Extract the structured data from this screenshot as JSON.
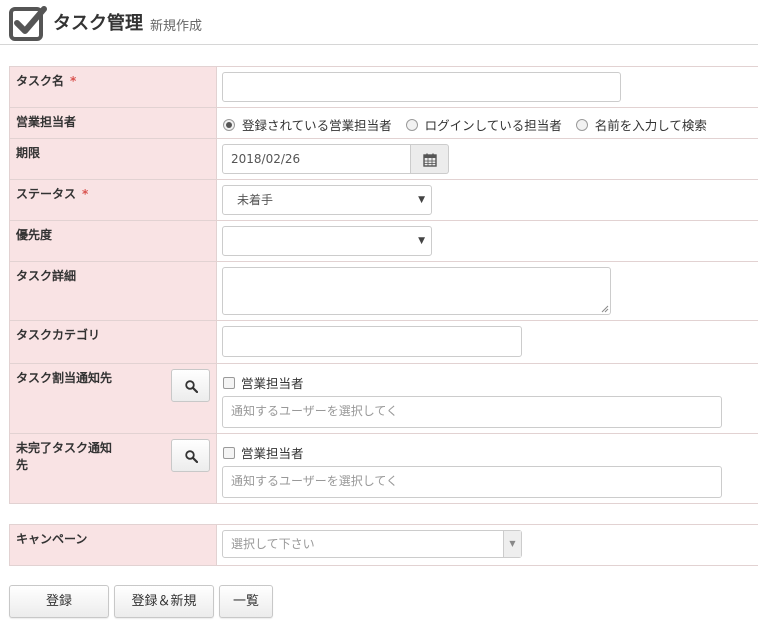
{
  "header": {
    "title": "タスク管理",
    "subtitle": "新規作成"
  },
  "fields": {
    "task_name": {
      "label": "タスク名",
      "required_mark": "*",
      "value": ""
    },
    "sales_rep": {
      "label": "営業担当者",
      "options": [
        "登録されている営業担当者",
        "ログインしている担当者",
        "名前を入力して検索"
      ],
      "selected_index": 0
    },
    "deadline": {
      "label": "期限",
      "value": "2018/02/26"
    },
    "status": {
      "label": "ステータス",
      "required_mark": "*",
      "value": "未着手"
    },
    "priority": {
      "label": "優先度",
      "value": ""
    },
    "task_detail": {
      "label": "タスク詳細",
      "value": ""
    },
    "task_category": {
      "label": "タスクカテゴリ",
      "value": ""
    },
    "assign_notify": {
      "label": "タスク割当通知先",
      "checkbox_label": "営業担当者",
      "placeholder": "通知するユーザーを選択してく"
    },
    "incomplete_notify": {
      "label_line1": "未完了タスク通知",
      "label_line2": "先",
      "checkbox_label": "営業担当者",
      "placeholder": "通知するユーザーを選択してく"
    },
    "campaign": {
      "label": "キャンペーン",
      "placeholder": "選択して下さい"
    }
  },
  "buttons": {
    "register": "登録",
    "register_new": "登録＆新規",
    "list": "一覧"
  },
  "icons": {
    "app": "checkbox-icon",
    "calendar": "calendar-icon",
    "search": "search-icon"
  },
  "colors": {
    "label_bg": "#f9e3e4",
    "required": "#d9534f"
  }
}
